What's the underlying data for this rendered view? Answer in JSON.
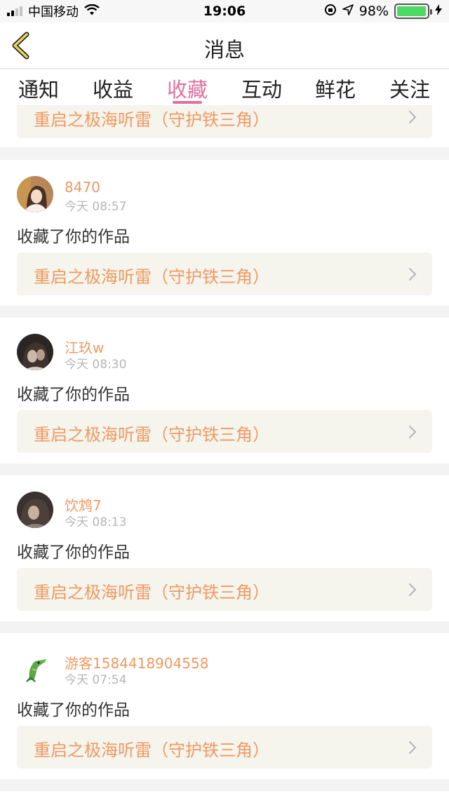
{
  "status_bar": {
    "carrier": "中国移动",
    "time": "19:06",
    "battery": "98%",
    "battery_level": 0.98,
    "signal_bars": 2
  },
  "nav": {
    "title": "消息"
  },
  "tabs": [
    {
      "label": "通知",
      "active": false
    },
    {
      "label": "收益",
      "active": false
    },
    {
      "label": "收藏",
      "active": true
    },
    {
      "label": "互动",
      "active": false
    },
    {
      "label": "鲜花",
      "active": false
    },
    {
      "label": "关注",
      "active": false
    }
  ],
  "colors": {
    "accent": "#e070a0",
    "name_orange": "#ef9a62",
    "link_bg": "#f5f4ed"
  },
  "partial_card": {
    "work_title": "重启之极海听雷（守护铁三角）"
  },
  "notifications": [
    {
      "user": "8470",
      "time": "今天 08:57",
      "action": "收藏了你的作品",
      "work_title": "重启之极海听雷（守护铁三角）",
      "avatar": "avatar-woman"
    },
    {
      "user": "江玖w",
      "time": "今天 08:30",
      "action": "收藏了你的作品",
      "work_title": "重启之极海听雷（守护铁三角）",
      "avatar": "avatar-dark-portrait"
    },
    {
      "user": "饮鸩7",
      "time": "今天 08:13",
      "action": "收藏了你的作品",
      "work_title": "重启之极海听雷（守护铁三角）",
      "avatar": "avatar-dark-portrait"
    },
    {
      "user": "游客1584418904558",
      "time": "今天 07:54",
      "action": "收藏了你的作品",
      "work_title": "重启之极海听雷（守护铁三角）",
      "avatar": "avatar-crocodile"
    }
  ]
}
